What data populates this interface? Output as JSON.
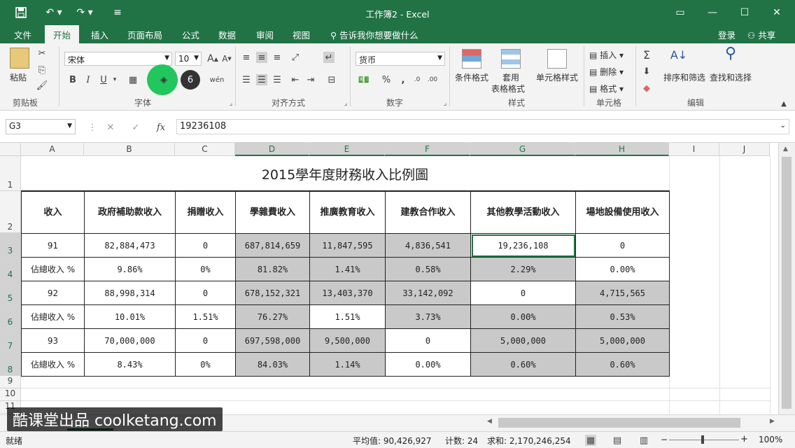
{
  "titlebar": {
    "title": "工作簿2 - Excel"
  },
  "menu": {
    "items": [
      "文件",
      "开始",
      "插入",
      "页面布局",
      "公式",
      "数据",
      "审阅",
      "视图"
    ],
    "active_index": 1,
    "tell_me": "告诉我你想要做什么",
    "login": "登录",
    "share": "共享"
  },
  "ribbon": {
    "clipboard": {
      "paste": "粘贴",
      "label": "剪贴板"
    },
    "font": {
      "name": "宋体",
      "size": "10",
      "bold": "B",
      "italic": "I",
      "underline": "U",
      "label": "字体",
      "font_color_badge": "6"
    },
    "alignment": {
      "label": "对齐方式"
    },
    "number": {
      "format": "货币",
      "label": "数字"
    },
    "styles": {
      "cond_format": "条件格式",
      "table_format_1": "套用",
      "table_format_2": "表格格式",
      "cell_style": "单元格样式",
      "label": "样式"
    },
    "cells": {
      "insert": "插入",
      "delete": "删除",
      "format": "格式",
      "label": "单元格"
    },
    "editing": {
      "sort_filter": "排序和筛选",
      "find_select": "查找和选择",
      "label": "编辑"
    }
  },
  "formula": {
    "namebox": "G3",
    "value": "19236108"
  },
  "columns": [
    "A",
    "B",
    "C",
    "D",
    "E",
    "F",
    "G",
    "H",
    "I",
    "J"
  ],
  "rows": [
    "1",
    "2",
    "3",
    "4",
    "5",
    "6",
    "7",
    "8",
    "9",
    "10",
    "11"
  ],
  "sheet": {
    "title": "2015學年度財務收入比例圖",
    "headers": [
      "收入",
      "政府補助款收入",
      "捐贈收入",
      "學雜費收入",
      "推廣教育收入",
      "建教合作收入",
      "其他教學活動收入",
      "場地設備使用收入"
    ],
    "data": [
      [
        "91",
        "82,884,473",
        "0",
        "687,814,659",
        "11,847,595",
        "4,836,541",
        "19,236,108",
        "0"
      ],
      [
        "佔總收入 %",
        "9.86%",
        "0%",
        "81.82%",
        "1.41%",
        "0.58%",
        "2.29%",
        "0.00%"
      ],
      [
        "92",
        "88,998,314",
        "0",
        "678,152,321",
        "13,403,370",
        "33,142,092",
        "0",
        "4,715,565"
      ],
      [
        "佔總收入 %",
        "10.01%",
        "1.51%",
        "76.27%",
        "1.51%",
        "3.73%",
        "0.00%",
        "0.53%"
      ],
      [
        "93",
        "70,000,000",
        "0",
        "697,598,000",
        "9,500,000",
        "0",
        "5,000,000",
        "5,000,000"
      ],
      [
        "佔總收入 %",
        "8.43%",
        "0%",
        "84.03%",
        "1.14%",
        "0.00%",
        "0.60%",
        "0.60%"
      ]
    ]
  },
  "watermark": "酷课堂出品 coolketang.com",
  "status": {
    "ready": "就绪",
    "average": "平均值: 90,426,927",
    "count": "计数: 24",
    "sum": "求和: 2,170,246,254",
    "zoom": "100%"
  }
}
